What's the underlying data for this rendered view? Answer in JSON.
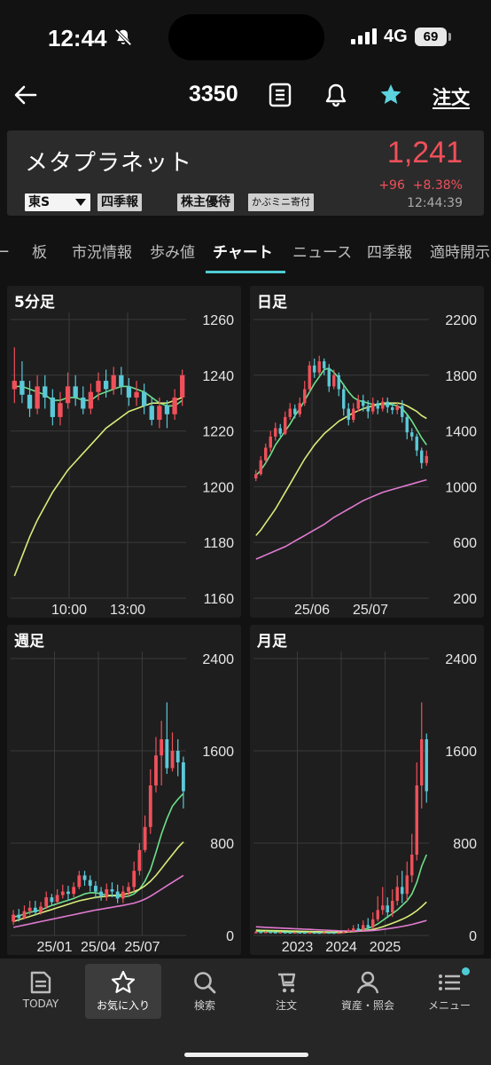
{
  "status_bar": {
    "time": "12:44",
    "network": "4G",
    "battery": "69"
  },
  "nav": {
    "code": "3350",
    "order_label": "注文"
  },
  "stock": {
    "name": "メタプラネット",
    "market": "東S",
    "badges": [
      "四季報",
      "株主優待",
      "かぶミニ寄付"
    ],
    "price": "1,241",
    "change": "+96",
    "change_pct": "+8.38%",
    "timestamp": "12:44:39"
  },
  "tabs": [
    "ー",
    "板",
    "市況情報",
    "歩み値",
    "チャート",
    "ニュース",
    "四季報",
    "適時開示"
  ],
  "active_tab": "チャート",
  "colors": {
    "up": "#f0505a",
    "down": "#5cc8d8",
    "ma_short": "#6ee08a",
    "ma_mid": "#d8ec7a",
    "ma_long": "#e07ad0",
    "accent": "#4ecbd4"
  },
  "chart_data": [
    {
      "type": "candlestick",
      "title": "5分足",
      "ylim": [
        1160,
        1260
      ],
      "y_ticks": [
        "1260",
        "1240",
        "1220",
        "1200",
        "1180",
        "1160"
      ],
      "x_ticks": [
        "10:00",
        "13:00"
      ],
      "candles": [
        [
          1235,
          1238,
          1230,
          1250
        ],
        [
          1238,
          1233,
          1230,
          1245
        ],
        [
          1233,
          1228,
          1225,
          1238
        ],
        [
          1228,
          1236,
          1226,
          1240
        ],
        [
          1236,
          1232,
          1228,
          1240
        ],
        [
          1232,
          1225,
          1222,
          1235
        ],
        [
          1225,
          1230,
          1222,
          1234
        ],
        [
          1230,
          1236,
          1228,
          1241
        ],
        [
          1236,
          1232,
          1229,
          1240
        ],
        [
          1232,
          1228,
          1226,
          1236
        ],
        [
          1228,
          1234,
          1226,
          1237
        ],
        [
          1234,
          1238,
          1231,
          1241
        ],
        [
          1238,
          1235,
          1232,
          1242
        ],
        [
          1235,
          1240,
          1233,
          1243
        ],
        [
          1240,
          1236,
          1233,
          1243
        ],
        [
          1236,
          1232,
          1229,
          1239
        ],
        [
          1232,
          1234,
          1229,
          1238
        ],
        [
          1234,
          1229,
          1226,
          1237
        ],
        [
          1229,
          1224,
          1222,
          1232
        ],
        [
          1224,
          1229,
          1221,
          1232
        ],
        [
          1229,
          1226,
          1221,
          1231
        ],
        [
          1226,
          1232,
          1224,
          1235
        ],
        [
          1232,
          1240,
          1229,
          1242
        ]
      ],
      "ma": [
        {
          "color": "ma_short",
          "values": [
            1236,
            1236,
            1235,
            1234,
            1233,
            1231,
            1231,
            1232,
            1232,
            1231,
            1231,
            1233,
            1234,
            1235,
            1236,
            1236,
            1235,
            1234,
            1232,
            1230,
            1229,
            1229,
            1231
          ]
        },
        {
          "color": "ma_mid",
          "values": [
            1168,
            1175,
            1182,
            1188,
            1193,
            1198,
            1202,
            1206,
            1209,
            1212,
            1215,
            1218,
            1221,
            1223,
            1225,
            1227,
            1228,
            1229,
            1230,
            1230,
            1230,
            1231,
            1232
          ]
        }
      ]
    },
    {
      "type": "candlestick",
      "title": "日足",
      "ylim": [
        200,
        2200
      ],
      "y_ticks": [
        "2200",
        "1800",
        "1400",
        "1000",
        "600",
        "200"
      ],
      "x_ticks": [
        "25/06",
        "25/07"
      ],
      "candles": [
        [
          1060,
          1090,
          1040,
          1120
        ],
        [
          1090,
          1190,
          1080,
          1220
        ],
        [
          1190,
          1280,
          1170,
          1310
        ],
        [
          1280,
          1360,
          1250,
          1400
        ],
        [
          1360,
          1420,
          1330,
          1460
        ],
        [
          1420,
          1380,
          1360,
          1450
        ],
        [
          1380,
          1500,
          1370,
          1540
        ],
        [
          1500,
          1560,
          1480,
          1600
        ],
        [
          1560,
          1520,
          1490,
          1590
        ],
        [
          1520,
          1600,
          1500,
          1640
        ],
        [
          1600,
          1700,
          1580,
          1760
        ],
        [
          1700,
          1870,
          1680,
          1900
        ],
        [
          1870,
          1820,
          1780,
          1920
        ],
        [
          1820,
          1900,
          1800,
          1940
        ],
        [
          1900,
          1850,
          1800,
          1920
        ],
        [
          1850,
          1720,
          1680,
          1880
        ],
        [
          1720,
          1800,
          1700,
          1840
        ],
        [
          1800,
          1700,
          1650,
          1820
        ],
        [
          1700,
          1560,
          1510,
          1740
        ],
        [
          1560,
          1480,
          1440,
          1600
        ],
        [
          1480,
          1560,
          1460,
          1600
        ],
        [
          1560,
          1620,
          1540,
          1660
        ],
        [
          1620,
          1580,
          1540,
          1660
        ],
        [
          1580,
          1540,
          1490,
          1620
        ],
        [
          1540,
          1600,
          1520,
          1640
        ],
        [
          1600,
          1560,
          1520,
          1620
        ],
        [
          1560,
          1610,
          1540,
          1640
        ],
        [
          1610,
          1570,
          1530,
          1640
        ],
        [
          1570,
          1550,
          1520,
          1600
        ],
        [
          1550,
          1580,
          1520,
          1600
        ],
        [
          1580,
          1500,
          1460,
          1620
        ],
        [
          1500,
          1390,
          1340,
          1520
        ],
        [
          1390,
          1360,
          1330,
          1420
        ],
        [
          1360,
          1260,
          1220,
          1380
        ],
        [
          1260,
          1170,
          1130,
          1280
        ],
        [
          1170,
          1220,
          1150,
          1260
        ]
      ],
      "ma": [
        {
          "color": "ma_short",
          "values": [
            1080,
            1120,
            1170,
            1230,
            1300,
            1350,
            1400,
            1450,
            1510,
            1560,
            1620,
            1680,
            1740,
            1790,
            1840,
            1850,
            1820,
            1780,
            1730,
            1680,
            1640,
            1620,
            1610,
            1600,
            1590,
            1590,
            1590,
            1590,
            1590,
            1580,
            1560,
            1520,
            1470,
            1410,
            1350,
            1300
          ]
        },
        {
          "color": "ma_mid",
          "values": [
            650,
            690,
            740,
            790,
            840,
            900,
            960,
            1020,
            1080,
            1140,
            1200,
            1250,
            1300,
            1340,
            1380,
            1410,
            1440,
            1470,
            1490,
            1510,
            1530,
            1545,
            1560,
            1570,
            1580,
            1590,
            1600,
            1600,
            1600,
            1600,
            1595,
            1580,
            1560,
            1540,
            1510,
            1490
          ]
        },
        {
          "color": "ma_long",
          "values": [
            480,
            495,
            510,
            525,
            540,
            555,
            570,
            590,
            610,
            630,
            650,
            670,
            690,
            710,
            730,
            755,
            780,
            800,
            820,
            840,
            860,
            880,
            900,
            915,
            930,
            945,
            960,
            970,
            980,
            990,
            1000,
            1010,
            1020,
            1030,
            1040,
            1050
          ]
        }
      ]
    },
    {
      "type": "candlestick",
      "title": "週足",
      "ylim": [
        0,
        2400
      ],
      "y_ticks": [
        "2400",
        "1600",
        "800",
        "0"
      ],
      "x_ticks": [
        "25/01",
        "25/04",
        "25/07"
      ],
      "candles": [
        [
          120,
          180,
          90,
          220
        ],
        [
          180,
          150,
          120,
          230
        ],
        [
          150,
          210,
          140,
          260
        ],
        [
          210,
          240,
          180,
          300
        ],
        [
          240,
          200,
          170,
          300
        ],
        [
          200,
          250,
          180,
          290
        ],
        [
          250,
          330,
          230,
          380
        ],
        [
          330,
          290,
          260,
          360
        ],
        [
          290,
          350,
          270,
          400
        ],
        [
          350,
          380,
          320,
          440
        ],
        [
          380,
          360,
          300,
          430
        ],
        [
          360,
          420,
          330,
          460
        ],
        [
          420,
          520,
          400,
          560
        ],
        [
          520,
          480,
          430,
          560
        ],
        [
          480,
          430,
          380,
          520
        ],
        [
          430,
          380,
          320,
          470
        ],
        [
          380,
          340,
          300,
          420
        ],
        [
          340,
          400,
          300,
          450
        ],
        [
          400,
          380,
          330,
          460
        ],
        [
          380,
          320,
          280,
          440
        ],
        [
          320,
          380,
          280,
          430
        ],
        [
          380,
          420,
          340,
          460
        ],
        [
          420,
          560,
          380,
          640
        ],
        [
          560,
          740,
          520,
          800
        ],
        [
          740,
          940,
          720,
          1040
        ],
        [
          940,
          1300,
          880,
          1440
        ],
        [
          1300,
          1560,
          1240,
          1720
        ],
        [
          1560,
          1700,
          1300,
          1860
        ],
        [
          1700,
          1450,
          1400,
          2020
        ],
        [
          1450,
          1600,
          1420,
          1760
        ],
        [
          1600,
          1500,
          1380,
          1700
        ],
        [
          1500,
          1250,
          1100,
          1550
        ]
      ],
      "ma": [
        {
          "color": "ma_short",
          "values": [
            160,
            170,
            185,
            200,
            210,
            220,
            240,
            260,
            275,
            290,
            305,
            320,
            340,
            360,
            370,
            370,
            360,
            350,
            345,
            340,
            335,
            340,
            360,
            400,
            470,
            570,
            720,
            880,
            1010,
            1120,
            1180,
            1230
          ]
        },
        {
          "color": "ma_mid",
          "values": [
            120,
            135,
            150,
            165,
            180,
            195,
            210,
            225,
            240,
            255,
            270,
            285,
            300,
            310,
            320,
            330,
            335,
            340,
            345,
            350,
            355,
            365,
            380,
            400,
            430,
            470,
            520,
            580,
            640,
            700,
            760,
            810
          ]
        },
        {
          "color": "ma_long",
          "values": [
            70,
            80,
            90,
            100,
            110,
            120,
            130,
            140,
            150,
            160,
            170,
            180,
            190,
            200,
            210,
            220,
            228,
            236,
            244,
            252,
            260,
            270,
            280,
            295,
            315,
            340,
            370,
            400,
            430,
            460,
            490,
            520
          ]
        }
      ]
    },
    {
      "type": "candlestick",
      "title": "月足",
      "ylim": [
        0,
        2400
      ],
      "y_ticks": [
        "2400",
        "1600",
        "800",
        "0"
      ],
      "x_ticks": [
        "2023",
        "2024",
        "2025"
      ],
      "candles": [
        [
          30,
          30,
          20,
          40
        ],
        [
          30,
          28,
          20,
          40
        ],
        [
          28,
          30,
          20,
          38
        ],
        [
          30,
          28,
          22,
          36
        ],
        [
          28,
          27,
          20,
          34
        ],
        [
          27,
          28,
          20,
          34
        ],
        [
          28,
          27,
          20,
          32
        ],
        [
          27,
          26,
          20,
          32
        ],
        [
          26,
          27,
          20,
          30
        ],
        [
          27,
          26,
          20,
          30
        ],
        [
          26,
          25,
          18,
          30
        ],
        [
          25,
          26,
          18,
          30
        ],
        [
          26,
          25,
          18,
          28
        ],
        [
          25,
          24,
          18,
          28
        ],
        [
          24,
          26,
          18,
          30
        ],
        [
          26,
          25,
          18,
          30
        ],
        [
          25,
          24,
          18,
          28
        ],
        [
          24,
          25,
          18,
          28
        ],
        [
          25,
          30,
          20,
          40
        ],
        [
          30,
          40,
          25,
          60
        ],
        [
          40,
          60,
          30,
          90
        ],
        [
          60,
          50,
          40,
          100
        ],
        [
          50,
          90,
          40,
          130
        ],
        [
          90,
          70,
          50,
          150
        ],
        [
          70,
          140,
          60,
          200
        ],
        [
          140,
          220,
          120,
          340
        ],
        [
          220,
          260,
          180,
          420
        ],
        [
          260,
          200,
          150,
          330
        ],
        [
          200,
          300,
          160,
          400
        ],
        [
          300,
          420,
          260,
          520
        ],
        [
          420,
          360,
          280,
          560
        ],
        [
          360,
          520,
          300,
          640
        ],
        [
          520,
          700,
          460,
          880
        ],
        [
          700,
          1300,
          650,
          1500
        ],
        [
          1300,
          1700,
          1100,
          2020
        ],
        [
          1700,
          1250,
          1150,
          1750
        ]
      ],
      "ma": [
        {
          "color": "ma_short",
          "values": [
            35,
            34,
            33,
            32,
            31,
            30,
            29,
            28,
            28,
            27,
            27,
            26,
            26,
            25,
            25,
            25,
            25,
            25,
            26,
            30,
            36,
            44,
            52,
            62,
            78,
            100,
            130,
            160,
            190,
            220,
            260,
            300,
            360,
            460,
            600,
            700
          ]
        },
        {
          "color": "ma_mid",
          "values": [
            45,
            44,
            43,
            42,
            41,
            40,
            39,
            38,
            37,
            36,
            35,
            34,
            33,
            32,
            31,
            30,
            30,
            30,
            30,
            31,
            33,
            36,
            40,
            45,
            52,
            62,
            75,
            90,
            106,
            122,
            140,
            160,
            185,
            215,
            250,
            290
          ]
        },
        {
          "color": "ma_long",
          "values": [
            75,
            72,
            70,
            68,
            66,
            64,
            62,
            60,
            58,
            56,
            54,
            52,
            50,
            48,
            46,
            44,
            42,
            40,
            39,
            38,
            37,
            37,
            38,
            40,
            43,
            47,
            52,
            58,
            64,
            71,
            78,
            86,
            95,
            106,
            118,
            130
          ]
        }
      ]
    }
  ],
  "bottom_nav": [
    "TODAY",
    "お気に入り",
    "検索",
    "注文",
    "資産・照会",
    "メニュー"
  ],
  "bottom_nav_active": 1
}
